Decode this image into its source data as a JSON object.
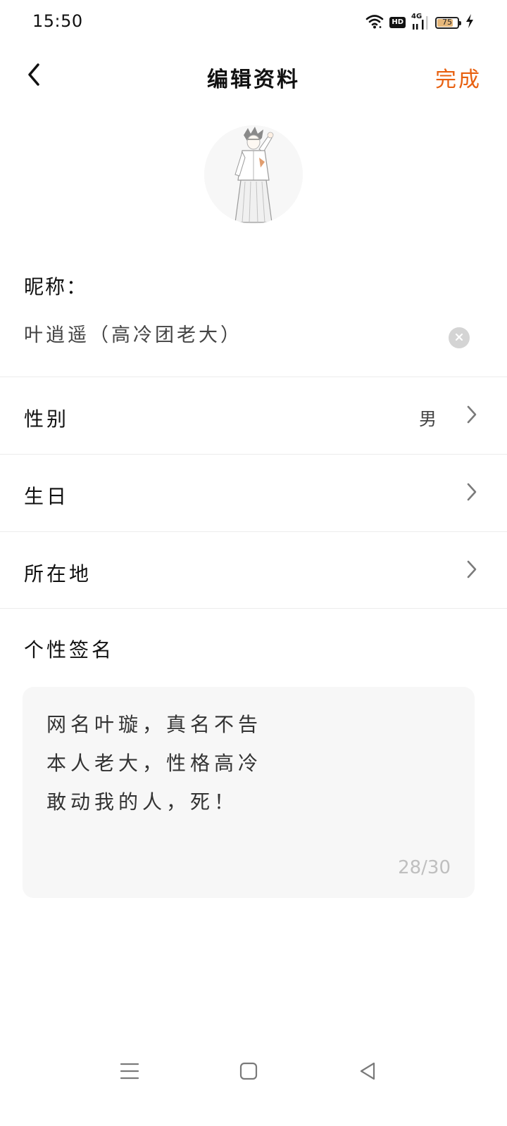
{
  "status_bar": {
    "time": "15:50",
    "hd_label": "HD",
    "network_label": "4G",
    "battery_level": "75",
    "icons": [
      "wifi-icon",
      "hd-icon",
      "signal-4g-icon",
      "battery-icon",
      "charging-icon"
    ]
  },
  "header": {
    "title": "编辑资料",
    "back_icon": "back-arrow-icon",
    "done_label": "完成"
  },
  "profile": {
    "avatar": "avatar-illustration"
  },
  "nickname": {
    "label": "昵称：",
    "value": "叶逍遥（高冷团老大）",
    "clear_icon": "clear-icon"
  },
  "rows": [
    {
      "label": "性别",
      "value": "男",
      "icon": "chevron-right-icon"
    },
    {
      "label": "生日",
      "value": "",
      "icon": "chevron-right-icon"
    },
    {
      "label": "所在地",
      "value": "",
      "icon": "chevron-right-icon"
    }
  ],
  "signature": {
    "label": "个性签名",
    "text": "网名叶璇，真名不告\n本人老大，性格高冷\n敢动我的人，死！",
    "count": "28/30"
  },
  "nav_bar": {
    "icons": [
      "menu-icon",
      "home-icon",
      "back-icon"
    ]
  },
  "colors": {
    "accent": "#e8600f",
    "text": "#111111",
    "muted": "#bfbfbf",
    "divider": "#ececec",
    "input_bg": "#f7f7f7"
  }
}
